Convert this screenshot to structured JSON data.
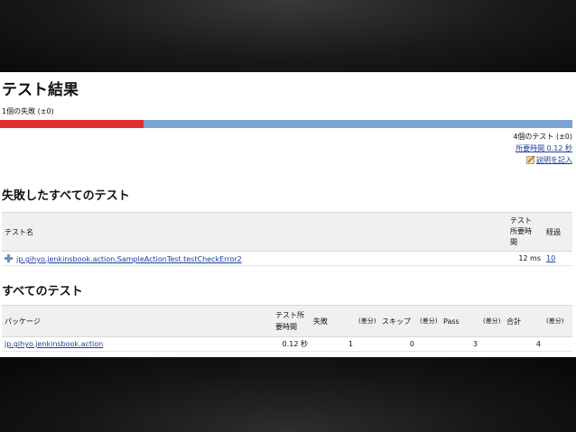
{
  "title": "テスト結果",
  "summary": {
    "fail_text": "1個の失敗 (±0)",
    "failed": 1,
    "total": 4,
    "test_count_text": "4個のテスト (±0)",
    "duration_link": "所要時間 0.12 秒",
    "add_description": "説明を記入"
  },
  "colors": {
    "fail": "#e0302e",
    "pass": "#7aa3d4",
    "link": "#1a3f9a"
  },
  "failed_section": {
    "heading": "失敗したすべてのテスト",
    "col_name": "テスト名",
    "col_duration_lines": [
      "テスト",
      "所要時",
      "間"
    ],
    "col_age": "経過",
    "rows": [
      {
        "name": "jp.gihyo.jenkinsbook.action.SampleActionTest.testCheckError2",
        "duration": "12 ms",
        "age": "10"
      }
    ]
  },
  "all_section": {
    "heading": "すべてのテスト",
    "headers": {
      "package": "パッケージ",
      "duration_lines": [
        "テスト所",
        "要時間"
      ],
      "fail": "失敗",
      "diff1": "(差分)",
      "skip": "スキップ",
      "diff2": "(差分)",
      "pass": "Pass",
      "diff3": "(差分)",
      "total": "合計",
      "diff4": "(差分)"
    },
    "rows": [
      {
        "package": "jp.gihyo.jenkinsbook.action",
        "duration": "0.12 秒",
        "fail": "1",
        "skip": "0",
        "pass": "3",
        "total": "4"
      }
    ]
  },
  "icons": [
    "expand-plus-icon",
    "edit-description-icon"
  ]
}
